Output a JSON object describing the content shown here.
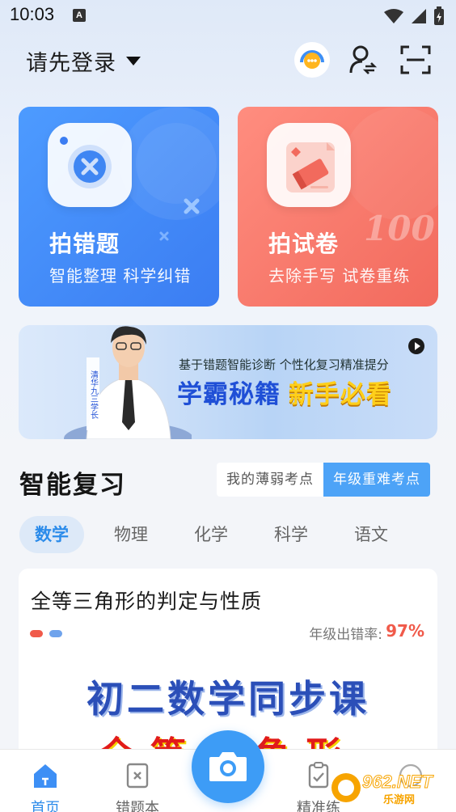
{
  "status_bar": {
    "time": "10:03",
    "notif_badge": "A"
  },
  "header": {
    "login_text": "请先登录"
  },
  "cards": [
    {
      "title": "拍错题",
      "subtitle": "智能整理 科学纠错"
    },
    {
      "title": "拍试卷",
      "subtitle": "去除手写 试卷重练",
      "deco_number": "100"
    }
  ],
  "banner": {
    "tag": "清华九三学长",
    "small_text": "基于错题智能诊断 个性化复习精准提分",
    "main_text": "学霸秘籍",
    "highlight_text": "新手必看"
  },
  "review": {
    "title": "智能复习",
    "toggle_off": "我的薄弱考点",
    "toggle_on": "年级重难考点"
  },
  "subjects": [
    "数学",
    "物理",
    "化学",
    "科学",
    "语文"
  ],
  "content": {
    "title": "全等三角形的判定与性质",
    "rate_label": "年级出错率:",
    "rate_value": "97%",
    "course_title": "初二数学同步课",
    "course_sub": "全等三角形"
  },
  "nav": {
    "home": "首页",
    "mistakes": "错题本",
    "practice": "精准练"
  },
  "watermark": {
    "brand": "962.NET",
    "sub": "乐游网"
  },
  "colors": {
    "primary": "#3d9cf6",
    "red": "#f05a4a"
  }
}
